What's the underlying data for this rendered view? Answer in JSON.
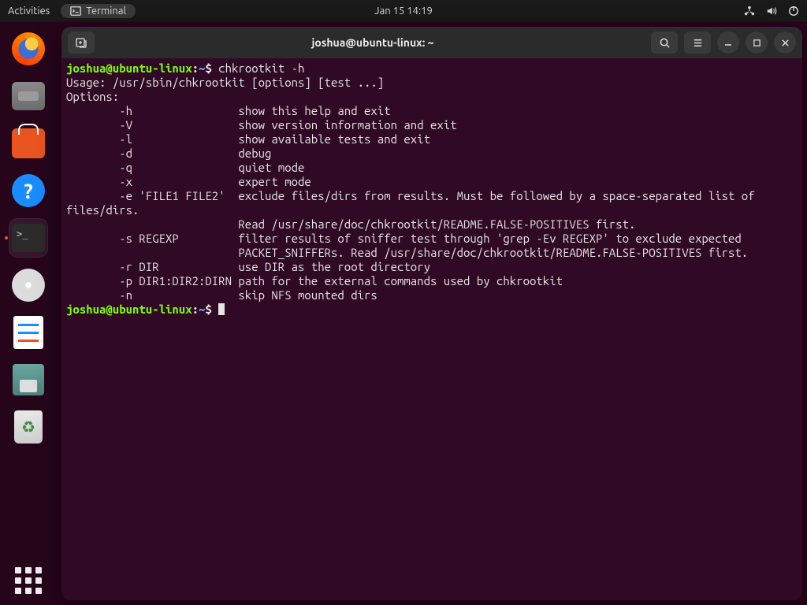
{
  "topbar": {
    "activities": "Activities",
    "app_name": "Terminal",
    "datetime": "Jan 15  14:19"
  },
  "dock": {
    "items": [
      "firefox",
      "files",
      "software",
      "help",
      "terminal",
      "disc",
      "text-editor",
      "disks",
      "trash"
    ]
  },
  "window": {
    "title": "joshua@ubuntu-linux: ~"
  },
  "term": {
    "prompt_user": "joshua@ubuntu-linux",
    "prompt_sep": ":",
    "prompt_path": "~",
    "prompt_end": "$",
    "cmd1": "chkrootkit -h",
    "output": "Usage: /usr/sbin/chkrootkit [options] [test ...]\nOptions:\n        -h                show this help and exit\n        -V                show version information and exit\n        -l                show available tests and exit\n        -d                debug\n        -q                quiet mode\n        -x                expert mode\n        -e 'FILE1 FILE2'  exclude files/dirs from results. Must be followed by a space-separated list of\nfiles/dirs.\n                          Read /usr/share/doc/chkrootkit/README.FALSE-POSITIVES first.\n        -s REGEXP         filter results of sniffer test through 'grep -Ev REGEXP' to exclude expected\n                          PACKET_SNIFFERs. Read /usr/share/doc/chkrootkit/README.FALSE-POSITIVES first.\n        -r DIR            use DIR as the root directory\n        -p DIR1:DIR2:DIRN path for the external commands used by chkrootkit\n        -n                skip NFS mounted dirs"
  }
}
